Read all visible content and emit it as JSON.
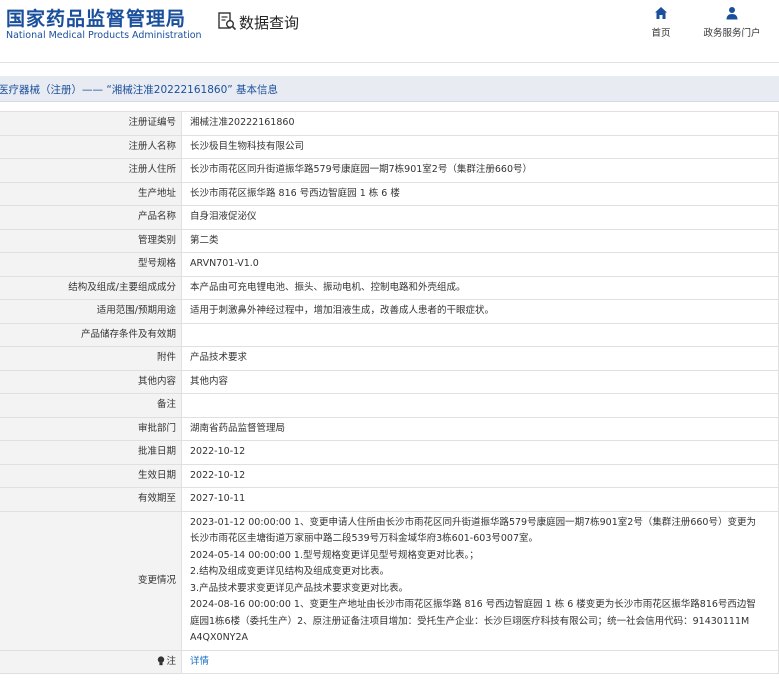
{
  "header": {
    "logo_cn": "国家药品监督管理局",
    "logo_en": "National Medical Products Administration",
    "query_title": "数据查询",
    "nav": {
      "home": "首页",
      "service": "政务服务门户"
    }
  },
  "breadcrumb": "医疗器械（注册）—— “湘械注准20222161860” 基本信息",
  "rows": [
    {
      "label": "注册证编号",
      "value": "湘械注准20222161860"
    },
    {
      "label": "注册人名称",
      "value": "长沙极目生物科技有限公司"
    },
    {
      "label": "注册人住所",
      "value": "长沙市雨花区同升街道振华路579号康庭园一期7栋901室2号（集群注册660号）"
    },
    {
      "label": "生产地址",
      "value": "长沙市雨花区振华路 816 号西边智庭园 1 栋 6 楼"
    },
    {
      "label": "产品名称",
      "value": "自身泪液促泌仪"
    },
    {
      "label": "管理类别",
      "value": "第二类"
    },
    {
      "label": "型号规格",
      "value": "ARVN701-V1.0"
    },
    {
      "label": "结构及组成/主要组成成分",
      "value": "本产品由可充电锂电池、振头、振动电机、控制电路和外壳组成。"
    },
    {
      "label": "适用范围/预期用途",
      "value": "适用于刺激鼻外神经过程中，增加泪液生成，改善成人患者的干眼症状。"
    },
    {
      "label": "产品储存条件及有效期",
      "value": ""
    },
    {
      "label": "附件",
      "value": "产品技术要求"
    },
    {
      "label": "其他内容",
      "value": "其他内容"
    },
    {
      "label": "备注",
      "value": ""
    },
    {
      "label": "审批部门",
      "value": "湖南省药品监督管理局"
    },
    {
      "label": "批准日期",
      "value": "2022-10-12"
    },
    {
      "label": "生效日期",
      "value": "2022-10-12"
    },
    {
      "label": "有效期至",
      "value": "2027-10-11"
    }
  ],
  "changes": {
    "label": "变更情况",
    "lines": [
      "2023-01-12 00:00:00 1、变更申请人住所由长沙市雨花区同升街道振华路579号康庭园一期7栋901室2号（集群注册660号）变更为",
      "长沙市雨花区圭塘街道万家丽中路二段539号万科金域华府3栋601-603号007室。",
      "2024-05-14 00:00:00 1.型号规格变更详见型号规格变更对比表。；",
      "2.结构及组成变更详见结构及组成变更对比表。",
      "3.产品技术要求变更详见产品技术要求变更对比表。",
      "2024-08-16 00:00:00 1、变更生产地址由长沙市雨花区振华路 816 号西边智庭园 1 栋 6 楼变更为长沙市雨花区振华路816号西边智",
      "庭园1栋6楼（委托生产）2、原注册证备注项目增加：受托生产企业：长沙巨翊医疗科技有限公司；统一社会信用代码：91430111M",
      "A4QX0NY2A"
    ]
  },
  "note": {
    "label": "注",
    "link": "详情"
  }
}
